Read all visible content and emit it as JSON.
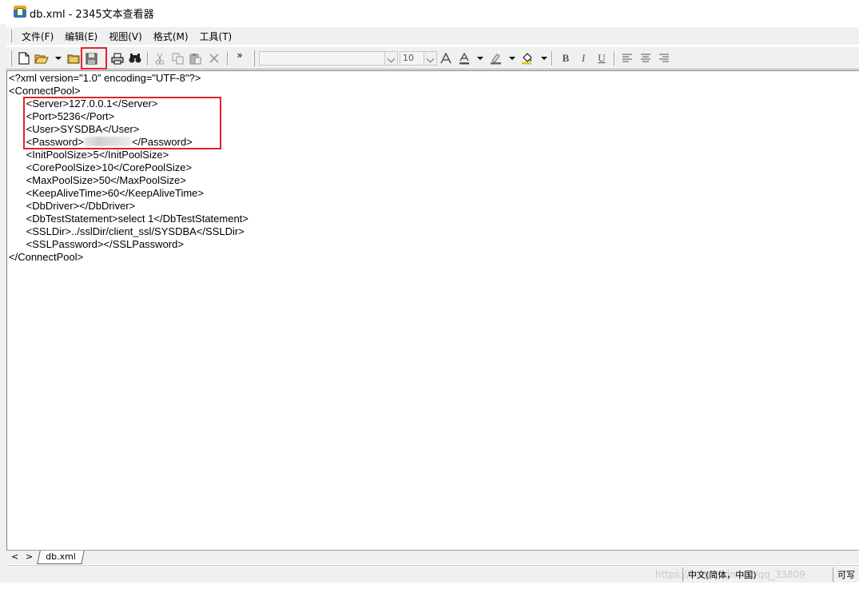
{
  "window": {
    "title": "db.xml - 2345文本查看器"
  },
  "menu": {
    "items": [
      "文件(F)",
      "编辑(E)",
      "视图(V)",
      "格式(M)",
      "工具(T)"
    ]
  },
  "toolbar": {
    "more_label": "»",
    "font_name": "",
    "font_size": "10",
    "bold_label": "B",
    "italic_label": "I",
    "underline_label": "U",
    "save_highlighted": true,
    "icons": [
      "new-file-icon",
      "open-folder-icon",
      "open-icon",
      "save-icon",
      "print-icon",
      "find-icon",
      "cut-icon",
      "copy-icon",
      "paste-icon",
      "delete-icon",
      "font-color-icon",
      "highlight-icon",
      "fill-icon",
      "align-left-icon",
      "align-center-icon",
      "align-right-icon"
    ]
  },
  "editor": {
    "lines": [
      "<?xml version=\"1.0\" encoding=\"UTF-8\"?>",
      "<ConnectPool>",
      "      <Server>127.0.0.1</Server>",
      "      <Port>5236</Port>",
      "      <User>SYSDBA</User>",
      "      <InitPoolSize>5</InitPoolSize>",
      "      <CorePoolSize>10</CorePoolSize>",
      "      <MaxPoolSize>50</MaxPoolSize>",
      "      <KeepAliveTime>60</KeepAliveTime>",
      "      <DbDriver></DbDriver>",
      "      <DbTestStatement>select 1</DbTestStatement>",
      "      <SSLDir>../sslDir/client_ssl/SYSDBA</SSLDir>",
      "      <SSLPassword></SSLPassword>",
      "</ConnectPool>"
    ],
    "password_open": "      <Password>",
    "password_close": "</Password>"
  },
  "tabs": {
    "prev": "<",
    "next": ">",
    "active": "db.xml"
  },
  "status": {
    "ime": "中文(简体，中国)",
    "mode": "可写",
    "watermark": "https://blog.csdn.net/qq_33809"
  }
}
